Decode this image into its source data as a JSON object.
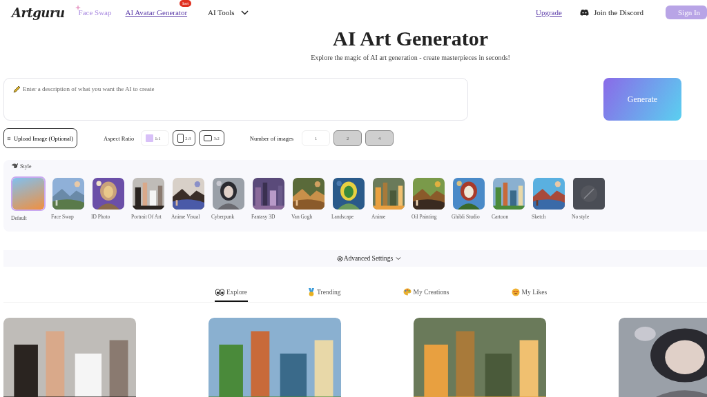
{
  "header": {
    "logo": "Artguru",
    "nav": [
      {
        "label": "Face Swap",
        "kind": "sparkle"
      },
      {
        "label": "AI Avatar Generator",
        "kind": "link",
        "badge": "hot"
      },
      {
        "label": "AI Tools",
        "kind": "menu"
      }
    ],
    "upgrade": "Upgrade",
    "discord": "Join the Discord",
    "sign_in": "Sign In"
  },
  "title": "AI Art Generator",
  "subtitle": "Explore the magic of AI art generation - create masterpieces in seconds!",
  "prompt": {
    "placeholder": "Enter a description of what you want the AI to create"
  },
  "generate": "Generate",
  "upload": "Upload Image (Optional)",
  "aspect_ratio": {
    "label": "Aspect Ratio",
    "options": [
      {
        "label": "1:1",
        "kind": "square",
        "selected": true
      },
      {
        "label": "2:3",
        "kind": "portrait",
        "selected": false
      },
      {
        "label": "3:2",
        "kind": "landscape",
        "selected": false
      }
    ]
  },
  "number_of_images": {
    "label": "Number of images",
    "options": [
      {
        "label": "1",
        "disabled": false
      },
      {
        "label": "2",
        "disabled": true
      },
      {
        "label": "4",
        "disabled": true
      }
    ]
  },
  "style": {
    "label": "Style",
    "items": [
      {
        "label": "Default",
        "kind": "gradient",
        "selected": true
      },
      {
        "label": "Face Swap",
        "kind": "picture",
        "selected": false
      },
      {
        "label": "ID Photo",
        "kind": "picture",
        "selected": false
      },
      {
        "label": "Portrait Of Art",
        "kind": "picture",
        "selected": false
      },
      {
        "label": "Anime Visual",
        "kind": "picture",
        "selected": false
      },
      {
        "label": "Cyberpunk",
        "kind": "picture",
        "selected": false
      },
      {
        "label": "Fantasy 3D",
        "kind": "picture",
        "selected": false
      },
      {
        "label": "Van Gogh",
        "kind": "picture",
        "selected": false
      },
      {
        "label": "Landscape",
        "kind": "picture",
        "selected": false
      },
      {
        "label": "Anime",
        "kind": "picture",
        "selected": false
      },
      {
        "label": "Oil Painting",
        "kind": "picture",
        "selected": false
      },
      {
        "label": "Ghibli Studio",
        "kind": "picture",
        "selected": false
      },
      {
        "label": "Cartoon",
        "kind": "picture",
        "selected": false
      },
      {
        "label": "Sketch",
        "kind": "picture",
        "selected": false
      },
      {
        "label": "No style",
        "kind": "none",
        "selected": false
      }
    ]
  },
  "advanced_settings": "Advanced Settings",
  "tabs": [
    {
      "label": "Explore",
      "selected": true
    },
    {
      "label": "Trending",
      "selected": false
    },
    {
      "label": "My Creations",
      "selected": false
    },
    {
      "label": "My Likes",
      "selected": false
    }
  ]
}
